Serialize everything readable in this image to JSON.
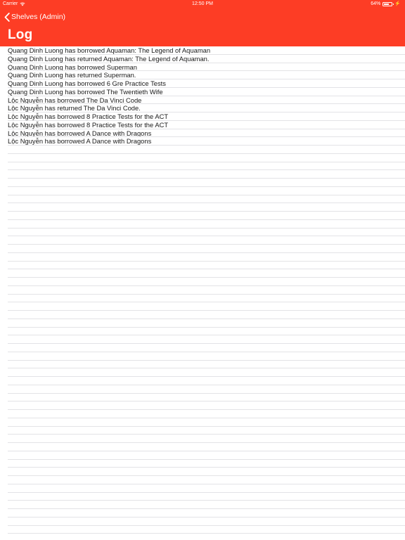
{
  "status_bar": {
    "carrier": "Carrier",
    "time": "12:50 PM",
    "battery": "64%",
    "battery_level": 0.64
  },
  "nav": {
    "back_label": "Shelves (Admin)",
    "title": "Log"
  },
  "log_entries": [
    "Quang Dinh Luong has borrowed Aquaman: The Legend of Aquaman",
    "Quang Dinh Luong has returned Aquaman: The Legend of Aquaman.",
    "Quang Dinh Luong has borrowed Superman",
    "Quang Dinh Luong has returned Superman.",
    "Quang Dinh Luong has borrowed 6 Gre Practice Tests",
    "Quang Dinh Luong has borrowed The Twentieth Wife",
    "Lộc Nguyễn has borrowed The Da Vinci Code",
    "Lộc Nguyễn has returned The Da Vinci Code.",
    "Lộc Nguyễn has borrowed 8 Practice Tests for the ACT",
    "Lộc Nguyễn has borrowed 8 Practice Tests for the ACT",
    "Lộc Nguyễn has borrowed A Dance with Dragons",
    "Lộc Nguyễn has borrowed A Dance with Dragons"
  ]
}
